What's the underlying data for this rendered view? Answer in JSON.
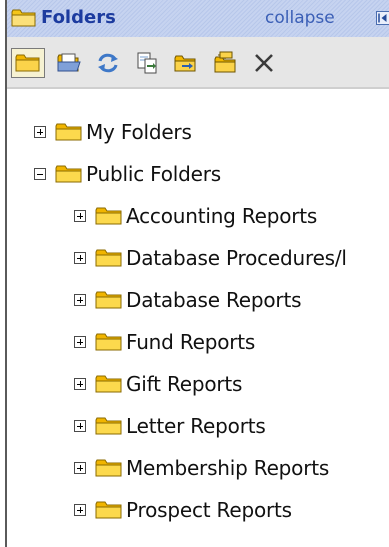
{
  "header": {
    "title": "Folders",
    "collapse_label": "collapse"
  },
  "toolbar": {
    "buttons": [
      {
        "name": "folder-view",
        "icon": "folder-icon",
        "active": true
      },
      {
        "name": "folder-open",
        "icon": "open-folder-icon",
        "active": false
      },
      {
        "name": "refresh",
        "icon": "refresh-icon",
        "active": false
      },
      {
        "name": "copy",
        "icon": "copy-icon",
        "active": false
      },
      {
        "name": "move",
        "icon": "move-folder-icon",
        "active": false
      },
      {
        "name": "new-folder",
        "icon": "new-folder-icon",
        "active": false
      },
      {
        "name": "delete",
        "icon": "delete-icon",
        "active": false
      }
    ]
  },
  "tree": {
    "my_folders": {
      "label": "My Folders",
      "expanded": false
    },
    "public_folders": {
      "label": "Public Folders",
      "expanded": true,
      "children": [
        {
          "label": "Accounting Reports",
          "expanded": false
        },
        {
          "label": "Database Procedures/l",
          "expanded": false
        },
        {
          "label": "Database Reports",
          "expanded": false
        },
        {
          "label": "Fund Reports",
          "expanded": false
        },
        {
          "label": "Gift Reports",
          "expanded": false
        },
        {
          "label": "Letter Reports",
          "expanded": false
        },
        {
          "label": "Membership Reports",
          "expanded": false
        },
        {
          "label": "Prospect Reports",
          "expanded": false
        }
      ]
    }
  },
  "colors": {
    "header_bg": "#c6d3f0",
    "header_title": "#1c3b9f",
    "folder_yellow": "#f7d23a",
    "toolbar_bg": "#e6e6e6"
  }
}
